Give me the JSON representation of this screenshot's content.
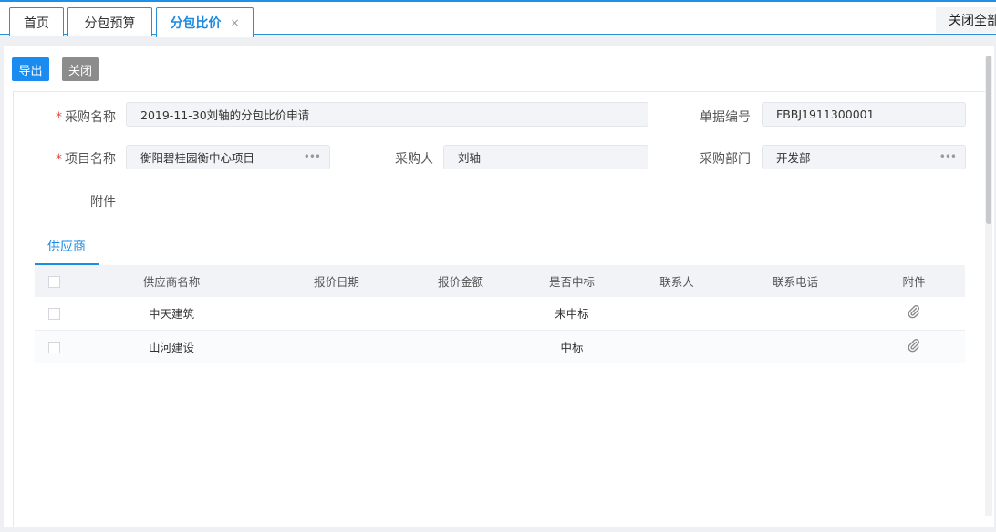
{
  "tabs": [
    {
      "label": "首页"
    },
    {
      "label": "分包预算"
    },
    {
      "label": "分包比价"
    }
  ],
  "tabs_close_glyph": "×",
  "close_all": "关闭全部",
  "toolbar": {
    "export": "导出",
    "close": "关闭"
  },
  "form": {
    "purchase_name_label": "采购名称",
    "purchase_name_value": "2019-11-30刘轴的分包比价申请",
    "doc_no_label": "单据编号",
    "doc_no_value": "FBBJ1911300001",
    "project_name_label": "项目名称",
    "project_name_value": "衡阳碧桂园衡中心项目",
    "buyer_label": "采购人",
    "buyer_value": "刘轴",
    "dept_label": "采购部门",
    "dept_value": "开发部",
    "attachment_label": "附件",
    "required_mark": "*",
    "more_glyph": "•••"
  },
  "subtab": "供应商",
  "table": {
    "headers": [
      "供应商名称",
      "报价日期",
      "报价金额",
      "是否中标",
      "联系人",
      "联系电话",
      "附件"
    ],
    "rows": [
      {
        "supplier": "中天建筑",
        "date": "",
        "amount": "",
        "won": "未中标",
        "contact": "",
        "phone": ""
      },
      {
        "supplier": "山河建设",
        "date": "",
        "amount": "",
        "won": "中标",
        "contact": "",
        "phone": ""
      }
    ]
  },
  "icons": {
    "attachment": "paperclip-icon",
    "tab_close": "close-icon"
  },
  "colors": {
    "primary": "#1a8cf0",
    "required": "#e5484d",
    "secondary_button": "#8c8c8c"
  }
}
